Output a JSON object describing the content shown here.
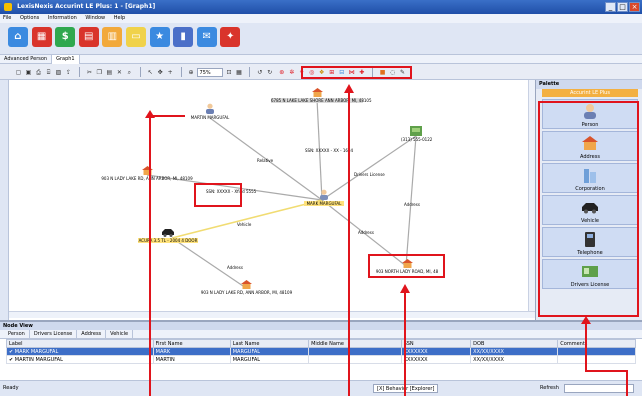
{
  "window": {
    "title": "LexisNexis Accurint LE Plus: 1 - [Graph1]"
  },
  "menu": [
    "File",
    "Options",
    "Information",
    "Window",
    "Help"
  ],
  "tabs": [
    "Advanced Person",
    "Graph1"
  ],
  "toolbar": {
    "zoom": "75%"
  },
  "graph": {
    "nodes": [
      {
        "id": "person1",
        "label": "MARTIN MARGUFAL"
      },
      {
        "id": "address1",
        "label": "6785 N LAKE LAKE SHORE ANN ARBOR, MI, 48105"
      },
      {
        "id": "address2",
        "label": "903 N LADY LAKE RD, ANN ARBOR, MI, 48109"
      },
      {
        "id": "phone1",
        "label": "(313) 555-0122"
      },
      {
        "id": "center",
        "label": "MARK MARGUFAL"
      },
      {
        "id": "vehicle1",
        "label": "ACURA 3.5 TL - 2004 4 DOOR"
      },
      {
        "id": "address3",
        "label": "903 NORTH LADY ROAD, MI, 48"
      },
      {
        "id": "address4",
        "label": "903 N LADY LAKE RD, ANN ARBOR, MI, 48109"
      }
    ],
    "edges": [
      {
        "label": "Relative"
      },
      {
        "label": "SSN: XXXXX - XX - 1604"
      },
      {
        "label": "Drivers License"
      },
      {
        "label": "SSN: XXXXX - Xfind 5555"
      },
      {
        "label": "Vehicle"
      },
      {
        "label": "Address"
      },
      {
        "label": "Address"
      },
      {
        "label": "Address"
      }
    ]
  },
  "palette": {
    "title": "Palette",
    "subtitle": "Accurint LE Plus",
    "items": [
      "Person",
      "Address",
      "Corporation",
      "Vehicle",
      "Telephone",
      "Drivers License"
    ]
  },
  "nodeview": {
    "title": "Node View",
    "tabs": [
      "Person",
      "Drivers License",
      "Address",
      "Vehicle"
    ],
    "columns": [
      "Label",
      "First Name",
      "Last Name",
      "Middle Name",
      "SSN",
      "DOB",
      "Comments"
    ],
    "rows": [
      [
        "MARK MARGUFAL",
        "MARK",
        "MARGUFAL",
        "",
        "XXXXXXX",
        "XX/XX/XXXX",
        ""
      ],
      [
        "MARTIN MARGUFAL",
        "MARTIN",
        "MARGUFAL",
        "",
        "XXXXXXX",
        "XX/XX/XXXX",
        ""
      ]
    ]
  },
  "status": {
    "left": "Ready",
    "center": "[X] Behavior  [Explorer]",
    "right": "Refresh"
  }
}
